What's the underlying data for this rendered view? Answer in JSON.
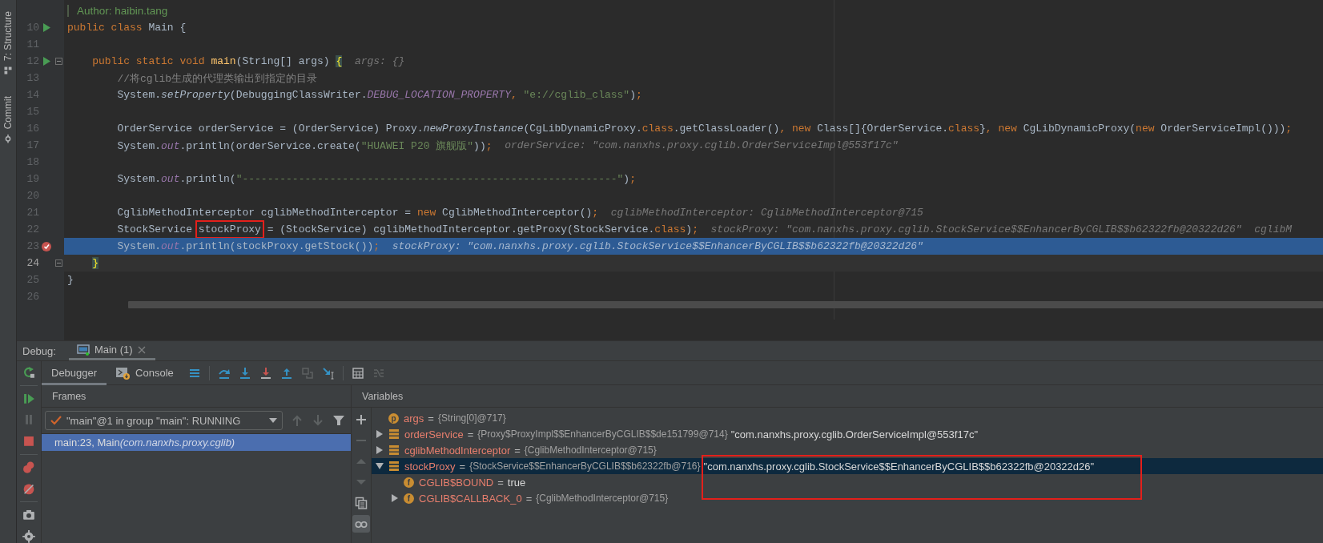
{
  "tool_strip": [
    {
      "kind": "structure",
      "label": "7: Structure"
    },
    {
      "kind": "commit",
      "label": "Commit"
    }
  ],
  "editor": {
    "lines": [
      {
        "run": false,
        "breakpoint": false,
        "fold": false,
        "current": false,
        "caret": false,
        "segments": [
          {
            "kind": "doc",
            "text": "Author: haibin.tang"
          }
        ]
      },
      {
        "number": "10",
        "run": true,
        "breakpoint": false,
        "fold": false,
        "current": false,
        "caret": false,
        "segments": [
          {
            "kind": "keyword",
            "text": "public class "
          },
          {
            "kind": "plain",
            "text": "Main {"
          }
        ]
      },
      {
        "number": "11",
        "run": false,
        "breakpoint": false,
        "fold": false,
        "current": false,
        "caret": false
      },
      {
        "number": "12",
        "run": true,
        "breakpoint": false,
        "fold": true,
        "current": false,
        "caret": false,
        "segments": [
          {
            "kind": "keyword",
            "text": "    public static void "
          },
          {
            "kind": "declaration",
            "text": "main"
          },
          {
            "kind": "plain",
            "text": "(String[] args) "
          },
          {
            "kind": "brace",
            "text": "{"
          }
        ],
        "hints": [
          "args: {}"
        ]
      },
      {
        "number": "13",
        "run": false,
        "breakpoint": false,
        "fold": false,
        "current": false,
        "caret": false,
        "segments": [
          {
            "kind": "comment",
            "text": "        //将cglib生成的代理类输出到指定的目录"
          }
        ]
      },
      {
        "number": "14",
        "run": false,
        "breakpoint": false,
        "fold": false,
        "current": false,
        "caret": false,
        "segments": [
          {
            "kind": "plain",
            "text": "        System."
          },
          {
            "kind": "static",
            "text": "setProperty"
          },
          {
            "kind": "plain",
            "text": "(DebuggingClassWriter."
          },
          {
            "kind": "constant",
            "text": "DEBUG_LOCATION_PROPERTY"
          },
          {
            "kind": "keyword",
            "text": ", "
          },
          {
            "kind": "string",
            "text": "\"e://cglib_class\""
          },
          {
            "kind": "plain",
            "text": ")"
          },
          {
            "kind": "keyword",
            "text": ";"
          }
        ]
      },
      {
        "number": "15",
        "run": false,
        "breakpoint": false,
        "fold": false,
        "current": false,
        "caret": false
      },
      {
        "number": "16",
        "run": false,
        "breakpoint": false,
        "fold": false,
        "current": false,
        "caret": false,
        "segments": [
          {
            "kind": "plain",
            "text": "        OrderService orderService = (OrderService) Proxy."
          },
          {
            "kind": "static",
            "text": "newProxyInstance"
          },
          {
            "kind": "plain",
            "text": "(CgLibDynamicProxy."
          },
          {
            "kind": "keyword",
            "text": "class"
          },
          {
            "kind": "plain",
            "text": ".getClassLoader()"
          },
          {
            "kind": "keyword",
            "text": ", new "
          },
          {
            "kind": "plain",
            "text": "Class[]{OrderService."
          },
          {
            "kind": "keyword",
            "text": "class"
          },
          {
            "kind": "plain",
            "text": "}"
          },
          {
            "kind": "keyword",
            "text": ", new "
          },
          {
            "kind": "plain",
            "text": "CgLibDynamicProxy("
          },
          {
            "kind": "keyword",
            "text": "new "
          },
          {
            "kind": "plain",
            "text": "OrderServiceImpl()))"
          },
          {
            "kind": "keyword",
            "text": ";"
          }
        ]
      },
      {
        "number": "17",
        "run": false,
        "breakpoint": false,
        "fold": false,
        "current": false,
        "caret": false,
        "segments": [
          {
            "kind": "plain",
            "text": "        System."
          },
          {
            "kind": "constant",
            "text": "out"
          },
          {
            "kind": "plain",
            "text": ".println(orderService.create("
          },
          {
            "kind": "string",
            "text": "\"HUAWEI P20 旗舰版\""
          },
          {
            "kind": "plain",
            "text": "))"
          },
          {
            "kind": "keyword",
            "text": ";"
          }
        ],
        "hints": [
          "orderService: \"com.nanxhs.proxy.cglib.OrderServiceImpl@553f17c\""
        ]
      },
      {
        "number": "18",
        "run": false,
        "breakpoint": false,
        "fold": false,
        "current": false,
        "caret": false
      },
      {
        "number": "19",
        "run": false,
        "breakpoint": false,
        "fold": false,
        "current": false,
        "caret": false,
        "segments": [
          {
            "kind": "plain",
            "text": "        System."
          },
          {
            "kind": "constant",
            "text": "out"
          },
          {
            "kind": "plain",
            "text": ".println("
          },
          {
            "kind": "string",
            "text": "\"------------------------------------------------------------\""
          },
          {
            "kind": "plain",
            "text": ")"
          },
          {
            "kind": "keyword",
            "text": ";"
          }
        ]
      },
      {
        "number": "20",
        "run": false,
        "breakpoint": false,
        "fold": false,
        "current": false,
        "caret": false
      },
      {
        "number": "21",
        "run": false,
        "breakpoint": false,
        "fold": false,
        "current": false,
        "caret": false,
        "segments": [
          {
            "kind": "plain",
            "text": "        CglibMethodInterceptor cglibMethodInterceptor = "
          },
          {
            "kind": "keyword",
            "text": "new "
          },
          {
            "kind": "plain",
            "text": "CglibMethodInterceptor()"
          },
          {
            "kind": "keyword",
            "text": ";"
          }
        ],
        "hints": [
          "cglibMethodInterceptor: CglibMethodInterceptor@715"
        ]
      },
      {
        "number": "22",
        "run": false,
        "breakpoint": false,
        "fold": false,
        "current": false,
        "caret": false,
        "segments": [
          {
            "kind": "plain",
            "text": "        StockService "
          },
          {
            "kind": "annotated",
            "text": "stockProxy"
          },
          {
            "kind": "plain",
            "text": " = (StockService) cglibMethodInterceptor.getProxy(StockService."
          },
          {
            "kind": "keyword",
            "text": "class"
          },
          {
            "kind": "plain",
            "text": ")"
          },
          {
            "kind": "keyword",
            "text": ";"
          }
        ],
        "hints": [
          "stockProxy: \"com.nanxhs.proxy.cglib.StockService$$EnhancerByCGLIB$$b62322fb@20322d26\"",
          "cglibM"
        ]
      },
      {
        "number": "23",
        "run": false,
        "breakpoint": true,
        "fold": false,
        "current": true,
        "caret": false,
        "segments": [
          {
            "kind": "plain",
            "text": "        System."
          },
          {
            "kind": "constant",
            "text": "out"
          },
          {
            "kind": "plain",
            "text": ".println(stockProxy.getStock())"
          },
          {
            "kind": "keyword",
            "text": ";"
          }
        ],
        "hints": [
          "stockProxy: \"com.nanxhs.proxy.cglib.StockService$$EnhancerByCGLIB$$b62322fb@20322d26\""
        ]
      },
      {
        "number": "24",
        "run": false,
        "breakpoint": false,
        "fold": true,
        "current": false,
        "caret": true,
        "segments": [
          {
            "kind": "brace",
            "text": "    }"
          }
        ]
      },
      {
        "number": "25",
        "run": false,
        "breakpoint": false,
        "fold": false,
        "current": false,
        "caret": false,
        "segments": [
          {
            "kind": "plain",
            "text": "}"
          }
        ]
      },
      {
        "number": "26",
        "run": false,
        "breakpoint": false,
        "fold": false,
        "current": false,
        "caret": false
      }
    ]
  },
  "debug": {
    "title": "Debug:",
    "session_tabs": [
      {
        "label": "Main (1)",
        "selected": true
      }
    ],
    "left_toolbar": [
      {
        "kind": "rerun",
        "disabled": false
      },
      {
        "kind": "resume",
        "disabled": false
      },
      {
        "kind": "pause",
        "disabled": true
      },
      {
        "kind": "stop",
        "disabled": false
      },
      {
        "kind": "breakpoints",
        "disabled": false
      },
      {
        "kind": "mute",
        "disabled": false
      },
      {
        "kind": "camera",
        "disabled": false
      },
      {
        "kind": "settings",
        "disabled": false
      }
    ],
    "tabs": [
      {
        "kind": "debugger",
        "label": "Debugger",
        "selected": true
      },
      {
        "kind": "console",
        "label": "Console",
        "selected": false
      }
    ],
    "toolbar": [
      {
        "kind": "layout",
        "disabled": false
      },
      {
        "kind": "step-over",
        "disabled": false
      },
      {
        "kind": "step-into",
        "disabled": false
      },
      {
        "kind": "force-step-into",
        "disabled": false
      },
      {
        "kind": "step-out",
        "disabled": false
      },
      {
        "kind": "drop-frame",
        "disabled": true
      },
      {
        "kind": "run-to-cursor",
        "disabled": false
      },
      {
        "kind": "evaluate",
        "disabled": false
      },
      {
        "kind": "trace",
        "disabled": true
      }
    ],
    "frames": {
      "title": "Frames",
      "thread": "\"main\"@1 in group \"main\": RUNNING",
      "nav": [
        {
          "kind": "nav-up",
          "disabled": true
        },
        {
          "kind": "nav-down",
          "disabled": true
        },
        {
          "kind": "filter",
          "disabled": false
        }
      ],
      "items": [
        {
          "location": "main:23, Main",
          "package": "(com.nanxhs.proxy.cglib)",
          "selected": true
        }
      ]
    },
    "variables": {
      "title": "Variables",
      "side_toolbar": [
        {
          "kind": "add",
          "disabled": false,
          "selected": false
        },
        {
          "kind": "remove",
          "disabled": true,
          "selected": false
        },
        {
          "kind": "up",
          "disabled": true,
          "selected": false
        },
        {
          "kind": "down",
          "disabled": true,
          "selected": false
        },
        {
          "kind": "copy",
          "disabled": false,
          "selected": false
        },
        {
          "kind": "watches",
          "disabled": false,
          "selected": true
        }
      ],
      "items": [
        {
          "kind": "parameter",
          "badge": "p",
          "name": "args",
          "operator": "=",
          "type": "{String[0]@717}",
          "selected": false
        },
        {
          "kind": "object",
          "name": "orderService",
          "operator": "=",
          "type": "{Proxy$ProxyImpl$$EnhancerByCGLIB$$de151799@714}",
          "value": "\"com.nanxhs.proxy.cglib.OrderServiceImpl@553f17c\"",
          "expanded": false,
          "selected": false,
          "boxed": false
        },
        {
          "kind": "object",
          "name": "cglibMethodInterceptor",
          "operator": "=",
          "type": "{CglibMethodInterceptor@715}",
          "expanded": false,
          "selected": false
        },
        {
          "kind": "object",
          "name": "stockProxy",
          "operator": "=",
          "type": "{StockService$$EnhancerByCGLIB$$b62322fb@716}",
          "value": "\"com.nanxhs.proxy.cglib.StockService$$EnhancerByCGLIB$$b62322fb@20322d26\"",
          "expanded": true,
          "selected": true,
          "boxed": true,
          "children": [
            {
              "kind": "field",
              "badge": "f",
              "name": "CGLIB$BOUND",
              "operator": "=",
              "value": "true",
              "selected": false,
              "boxed": false
            },
            {
              "kind": "field",
              "badge": "f",
              "name": "CGLIB$CALLBACK_0",
              "operator": "=",
              "type": "{CglibMethodInterceptor@715}",
              "expanded": false,
              "selected": false
            }
          ]
        }
      ]
    }
  }
}
